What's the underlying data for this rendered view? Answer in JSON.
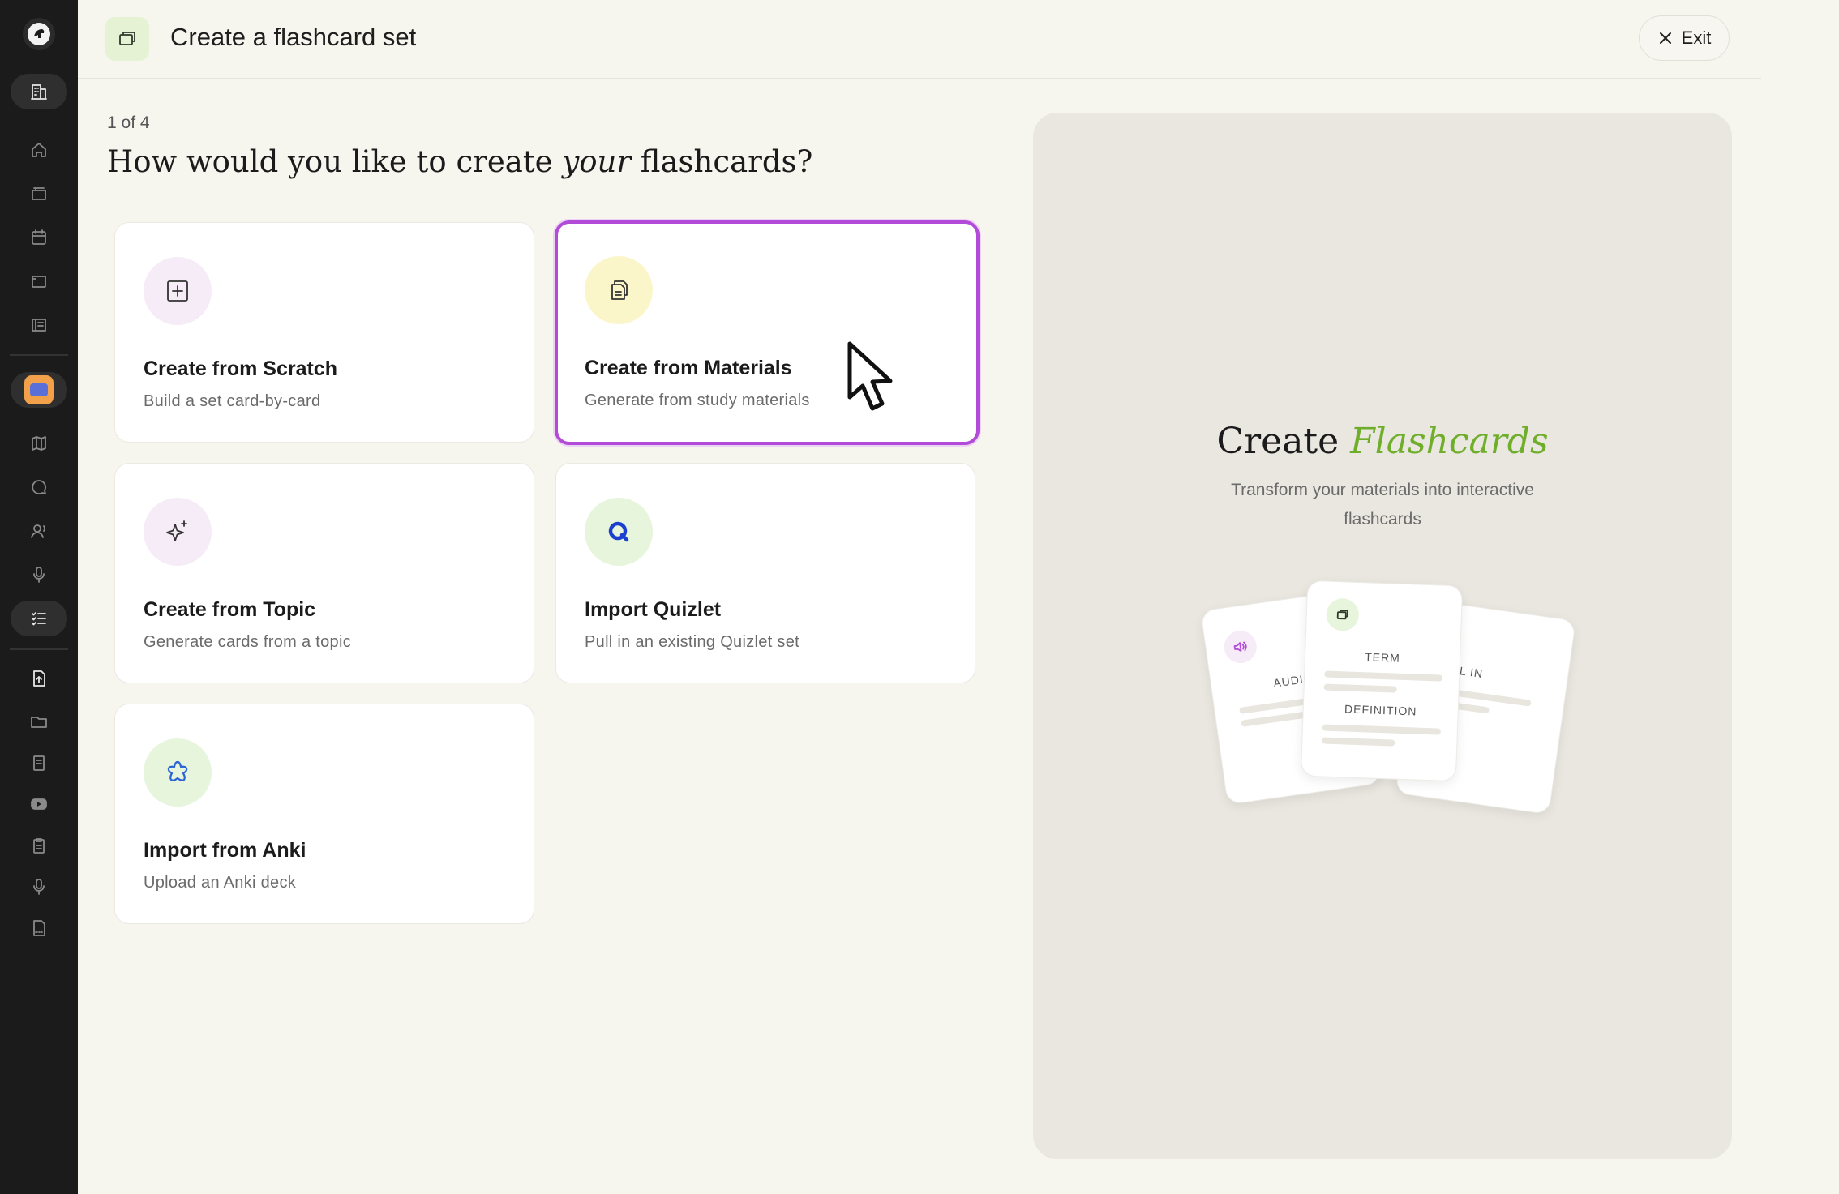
{
  "header": {
    "title": "Create a flashcard set",
    "exit_label": "Exit"
  },
  "wizard": {
    "step": "1 of 4",
    "heading_pre": "How would you like to create ",
    "heading_em": "your",
    "heading_post": " flashcards?"
  },
  "options": [
    {
      "title": "Create from Scratch",
      "subtitle": "Build a set card-by-card",
      "icon": "plus-square-icon",
      "icon_bg": "#f6ecf7"
    },
    {
      "title": "Create from Materials",
      "subtitle": "Generate from study materials",
      "icon": "documents-icon",
      "icon_bg": "#fbf6c9",
      "selected": true
    },
    {
      "title": "Create from Topic",
      "subtitle": "Generate cards from a topic",
      "icon": "sparkle-icon",
      "icon_bg": "#f6ecf7"
    },
    {
      "title": "Import Quizlet",
      "subtitle": "Pull in an existing Quizlet set",
      "icon": "quizlet-icon",
      "icon_bg": "#e6f5dc"
    },
    {
      "title": "Import from Anki",
      "subtitle": "Upload an Anki deck",
      "icon": "anki-star-icon",
      "icon_bg": "#e6f5dc"
    }
  ],
  "preview": {
    "title_pre": "Create ",
    "title_em": "Flashcards",
    "subtitle": "Transform your materials into interactive flashcards",
    "card_labels": {
      "audio": "AUDIO",
      "term": "TERM",
      "definition": "DEFINITION",
      "fill_in": "FILL IN"
    }
  },
  "colors": {
    "accent_selected": "#b24bd8",
    "flashcards_green": "#6fae2a",
    "sidebar_bg": "#1b1b1b",
    "page_bg": "#f6f5ee"
  },
  "sidebar": {
    "icons": [
      "logo-icon",
      "building-icon",
      "home-icon",
      "folder-stack-icon",
      "calendar-icon",
      "card-icon",
      "library-icon",
      "avatar",
      "map-icon",
      "chat-icon",
      "voice-user-icon",
      "microphone-icon",
      "checklist-icon",
      "file-upload-icon",
      "folder-icon",
      "notes-icon",
      "youtube-icon",
      "clipboard-icon",
      "microphone-icon",
      "pdf-icon"
    ]
  }
}
